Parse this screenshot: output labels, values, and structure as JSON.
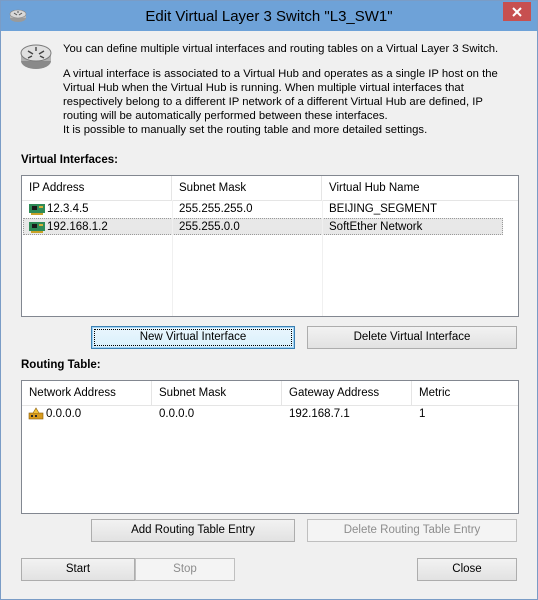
{
  "window": {
    "title": "Edit Virtual Layer 3 Switch \"L3_SW1\""
  },
  "intro": {
    "para1": "You can define multiple virtual interfaces and routing tables on a Virtual Layer 3 Switch.",
    "para2": "A virtual interface is associated to a Virtual Hub and operates as a single IP host on the Virtual Hub when the Virtual Hub is running. When multiple virtual interfaces that respectively belong to a different IP network of a different Virtual Hub are defined, IP routing will be automatically performed between these interfaces.",
    "para3": "It is possible to manually set the routing table and more detailed settings."
  },
  "interfaces": {
    "label": "Virtual Interfaces:",
    "columns": [
      "IP Address",
      "Subnet Mask",
      "Virtual Hub Name"
    ],
    "rows": [
      {
        "ip": "12.3.4.5",
        "mask": "255.255.255.0",
        "hub": "BEIJING_SEGMENT",
        "icon": "network-card-icon"
      },
      {
        "ip": "192.168.1.2",
        "mask": "255.255.0.0",
        "hub": "SoftEther Network",
        "icon": "network-card-icon"
      }
    ],
    "new_button": "New Virtual Interface",
    "delete_button": "Delete Virtual Interface"
  },
  "routing": {
    "label": "Routing Table:",
    "columns": [
      "Network Address",
      "Subnet Mask",
      "Gateway Address",
      "Metric"
    ],
    "rows": [
      {
        "network": "0.0.0.0",
        "mask": "0.0.0.0",
        "gateway": "192.168.7.1",
        "metric": "1",
        "icon": "router-icon"
      }
    ],
    "add_button": "Add Routing Table Entry",
    "delete_button": "Delete Routing Table Entry"
  },
  "footer": {
    "start": "Start",
    "stop": "Stop",
    "close": "Close"
  },
  "colors": {
    "titlebar": "#6ea2d8",
    "close_button": "#c75050",
    "selected_row": "#e8e8e8"
  }
}
